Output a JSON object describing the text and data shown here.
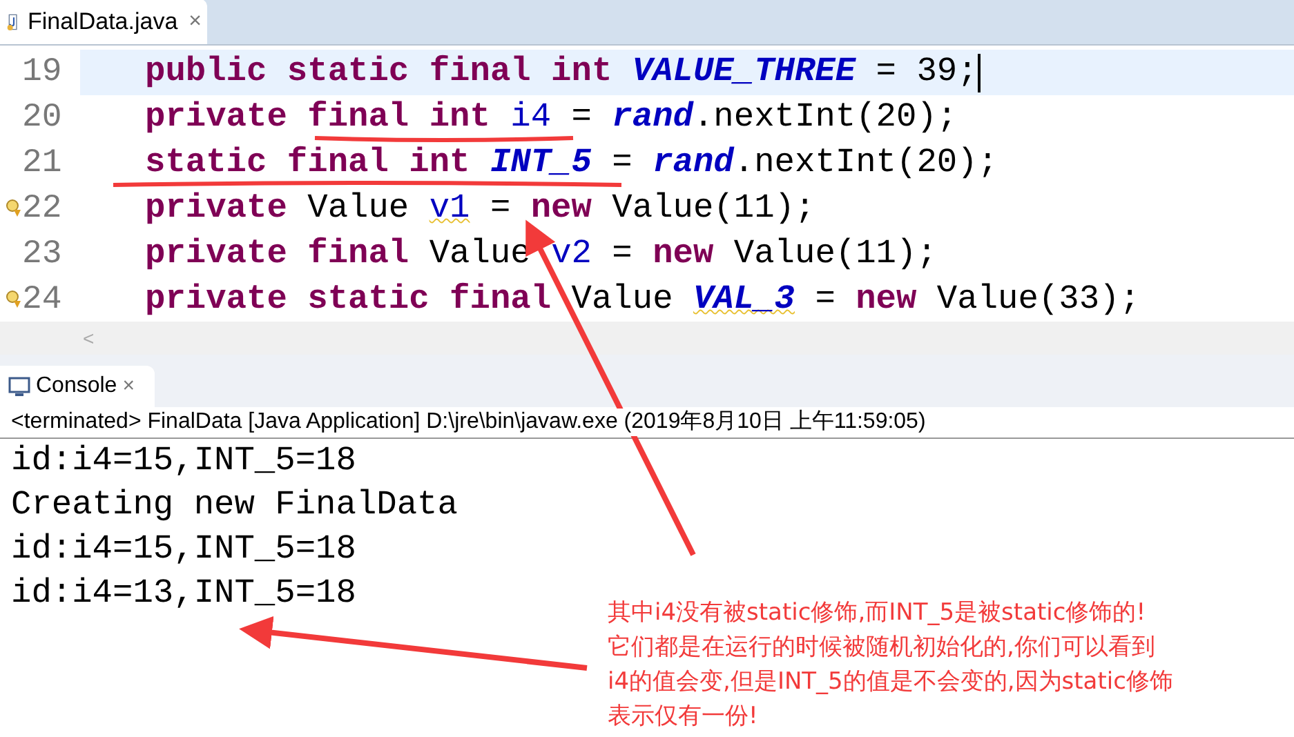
{
  "editor_tab": {
    "label": "FinalData.java",
    "close": "×"
  },
  "code_lines": [
    {
      "number": "19",
      "current": true,
      "warning_marker": false,
      "tokens": [
        {
          "kind": "keyword",
          "text": "public static final int "
        },
        {
          "kind": "static",
          "text": "VALUE_THREE"
        },
        {
          "kind": "plain",
          "text": " = 39;"
        }
      ]
    },
    {
      "number": "20",
      "current": false,
      "warning_marker": false,
      "tokens": [
        {
          "kind": "keyword",
          "text": "private final int "
        },
        {
          "kind": "field",
          "text": "i4"
        },
        {
          "kind": "plain",
          "text": " = "
        },
        {
          "kind": "static",
          "text": "rand"
        },
        {
          "kind": "plain",
          "text": ".nextInt(20);"
        }
      ]
    },
    {
      "number": "21",
      "current": false,
      "warning_marker": false,
      "tokens": [
        {
          "kind": "keyword",
          "text": "static final int "
        },
        {
          "kind": "static",
          "text": "INT_5"
        },
        {
          "kind": "plain",
          "text": " = "
        },
        {
          "kind": "static",
          "text": "rand"
        },
        {
          "kind": "plain",
          "text": ".nextInt(20);"
        }
      ]
    },
    {
      "number": "22",
      "current": false,
      "warning_marker": true,
      "tokens": [
        {
          "kind": "keyword",
          "text": "private "
        },
        {
          "kind": "plain",
          "text": "Value "
        },
        {
          "kind": "field",
          "text": "v1",
          "warning": true
        },
        {
          "kind": "plain",
          "text": " = "
        },
        {
          "kind": "keyword",
          "text": "new"
        },
        {
          "kind": "plain",
          "text": " Value(11);"
        }
      ]
    },
    {
      "number": "23",
      "current": false,
      "warning_marker": false,
      "tokens": [
        {
          "kind": "keyword",
          "text": "private final "
        },
        {
          "kind": "plain",
          "text": "Value "
        },
        {
          "kind": "field",
          "text": "v2"
        },
        {
          "kind": "plain",
          "text": " = "
        },
        {
          "kind": "keyword",
          "text": "new"
        },
        {
          "kind": "plain",
          "text": " Value(11);"
        }
      ]
    },
    {
      "number": "24",
      "current": false,
      "warning_marker": true,
      "tokens": [
        {
          "kind": "keyword",
          "text": "private static final "
        },
        {
          "kind": "plain",
          "text": "Value "
        },
        {
          "kind": "static",
          "text": "VAL_3",
          "warning": true
        },
        {
          "kind": "plain",
          "text": " = "
        },
        {
          "kind": "keyword",
          "text": "new"
        },
        {
          "kind": "plain",
          "text": " Value(33);"
        }
      ]
    }
  ],
  "scroll_left": "<",
  "console_tab": {
    "label": "Console",
    "close": "×"
  },
  "console_status": "<terminated> FinalData [Java Application] D:\\jre\\bin\\javaw.exe (2019年8月10日 上午11:59:05)",
  "console_output": [
    "id:i4=15,INT_5=18",
    "Creating new FinalData",
    "id:i4=15,INT_5=18",
    "id:i4=13,INT_5=18"
  ],
  "annotation": {
    "lines": [
      "其中i4没有被static修饰,而INT_5是被static修饰的!",
      "它们都是在运行的时候被随机初始化的,你们可以看到",
      "i4的值会变,但是INT_5的值是不会变的,因为static修饰",
      "表示仅有一份!"
    ]
  }
}
